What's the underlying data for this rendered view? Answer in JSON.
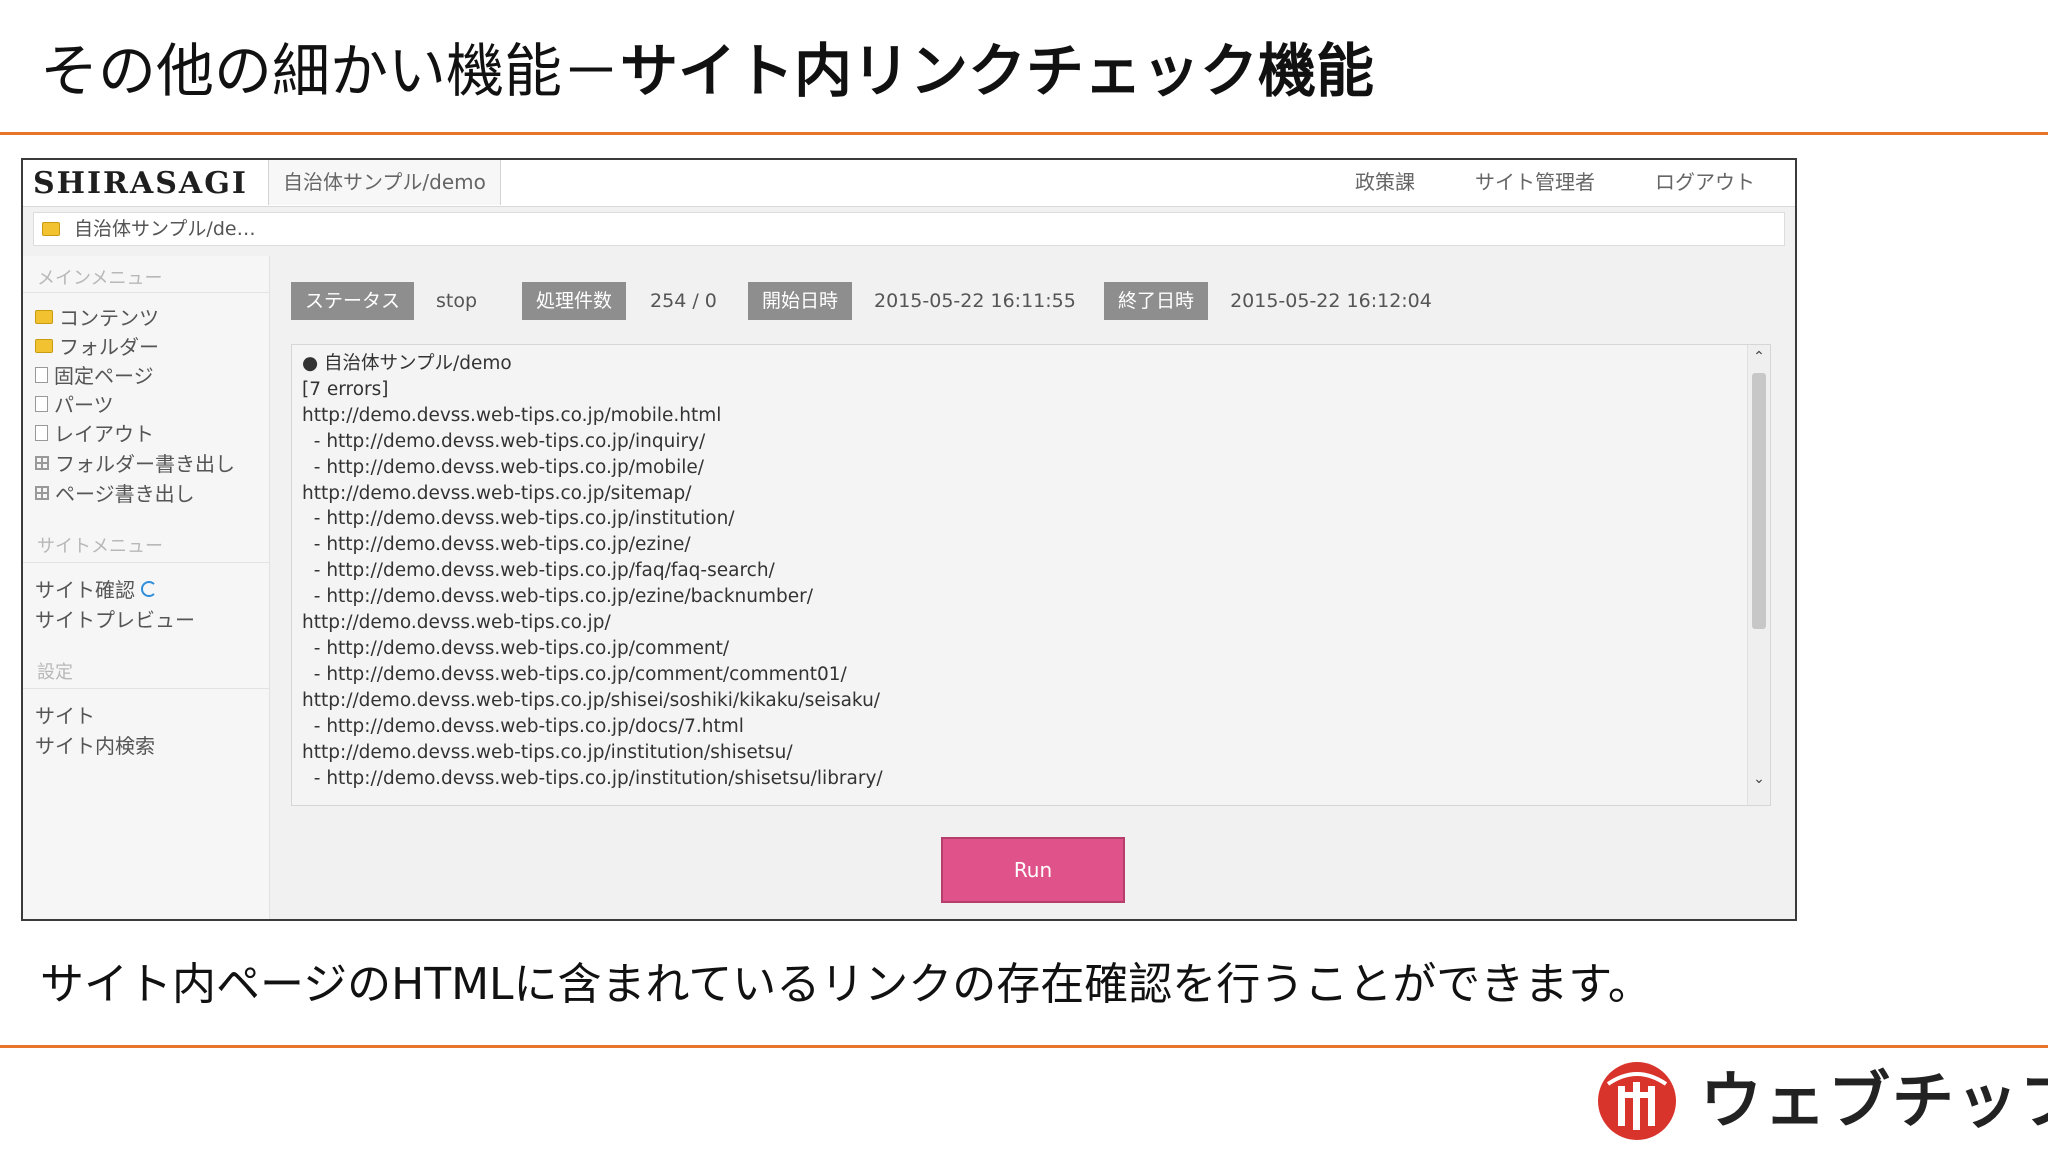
{
  "slide": {
    "title_prefix": "その他の細かい機能－",
    "title_strong": "サイト内リンクチェック機能",
    "caption": "サイト内ページのHTMLに含まれているリンクの存在確認を行うことができます。",
    "brand_name": "ウェブチップス"
  },
  "app": {
    "logo": "SHIRASAGI",
    "site_tab": "自治体サンプル/demo",
    "top_nav": [
      "政策課",
      "サイト管理者",
      "ログアウト"
    ],
    "breadcrumb": "自治体サンプル/de…"
  },
  "sidebar": {
    "main_menu_heading": "メインメニュー",
    "main_menu": [
      {
        "label": "コンテンツ",
        "icon": "folder-icon"
      },
      {
        "label": "フォルダー",
        "icon": "folder-icon"
      },
      {
        "label": "固定ページ",
        "icon": "page-icon"
      },
      {
        "label": "パーツ",
        "icon": "page-icon"
      },
      {
        "label": "レイアウト",
        "icon": "page-icon"
      },
      {
        "label": "フォルダー書き出し",
        "icon": "grid-icon"
      },
      {
        "label": "ページ書き出し",
        "icon": "grid-icon"
      }
    ],
    "site_menu_heading": "サイトメニュー",
    "site_menu": [
      "サイト確認",
      "サイトプレビュー"
    ],
    "settings_heading": "設定",
    "settings_menu": [
      "サイト",
      "サイト内検索"
    ]
  },
  "status": {
    "status_label": "ステータス",
    "status_value": "stop",
    "count_label": "処理件数",
    "count_value": "254 / 0",
    "start_label": "開始日時",
    "start_value": "2015-05-22 16:11:55",
    "end_label": "終了日時",
    "end_value": "2015-05-22 16:12:04"
  },
  "log": {
    "lines": [
      "● 自治体サンプル/demo",
      "[7 errors]",
      "http://demo.devss.web-tips.co.jp/mobile.html",
      "  - http://demo.devss.web-tips.co.jp/inquiry/",
      "  - http://demo.devss.web-tips.co.jp/mobile/",
      "http://demo.devss.web-tips.co.jp/sitemap/",
      "  - http://demo.devss.web-tips.co.jp/institution/",
      "  - http://demo.devss.web-tips.co.jp/ezine/",
      "  - http://demo.devss.web-tips.co.jp/faq/faq-search/",
      "  - http://demo.devss.web-tips.co.jp/ezine/backnumber/",
      "http://demo.devss.web-tips.co.jp/",
      "  - http://demo.devss.web-tips.co.jp/comment/",
      "  - http://demo.devss.web-tips.co.jp/comment/comment01/",
      "http://demo.devss.web-tips.co.jp/shisei/soshiki/kikaku/seisaku/",
      "  - http://demo.devss.web-tips.co.jp/docs/7.html",
      "http://demo.devss.web-tips.co.jp/institution/shisetsu/",
      "  - http://demo.devss.web-tips.co.jp/institution/shisetsu/library/"
    ]
  },
  "run_button": "Run",
  "colors": {
    "accent_rule": "#e8752a",
    "run_button": "#e0528a",
    "badge": "#8e8e8e",
    "brand_red": "#d9342b"
  }
}
